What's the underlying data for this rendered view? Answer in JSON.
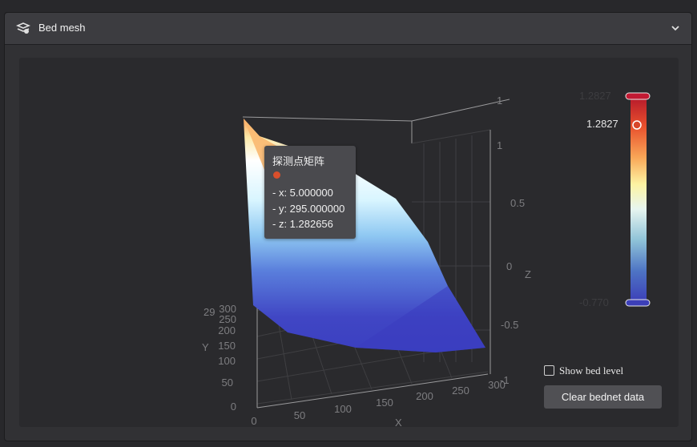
{
  "panel": {
    "title": "Bed mesh",
    "icon": "bed-mesh-icon",
    "collapse_icon": "chevron-down-icon"
  },
  "chart_data": {
    "type": "surface",
    "xlabel": "X",
    "ylabel": "Y",
    "zlabel": "Z",
    "x_ticks": [
      "0",
      "50",
      "100",
      "150",
      "200",
      "250",
      "300"
    ],
    "y_ticks": [
      "0",
      "50",
      "100",
      "150",
      "200",
      "250",
      "300"
    ],
    "z_ticks": [
      "-1",
      "-0.5",
      "0",
      "0.5",
      "1"
    ],
    "xlim": [
      0,
      300
    ],
    "ylim": [
      0,
      300
    ],
    "zlim": [
      -1,
      1
    ],
    "highlighted_point": {
      "x": 5.0,
      "y": 295.0,
      "z": 1.282656
    }
  },
  "tooltip": {
    "title": "探测点矩阵",
    "lines": [
      "- x: 5.000000",
      "- y: 295.000000",
      "- z: 1.282656"
    ],
    "marker_color": "#d94f2c"
  },
  "visual_map": {
    "current_label": "1.2827",
    "max": 1.2827,
    "colors": [
      "#3c3fb8",
      "#4e74c4",
      "#8fc3d8",
      "#e7f5f0",
      "#fdf3a2",
      "#f9a657",
      "#e8502d",
      "#b3162c"
    ],
    "handle_color": "#c21a33"
  },
  "controls": {
    "show_bed_level_label": "Show bed level",
    "show_bed_level_checked": false,
    "clear_button_label": "Clear bednet data"
  }
}
